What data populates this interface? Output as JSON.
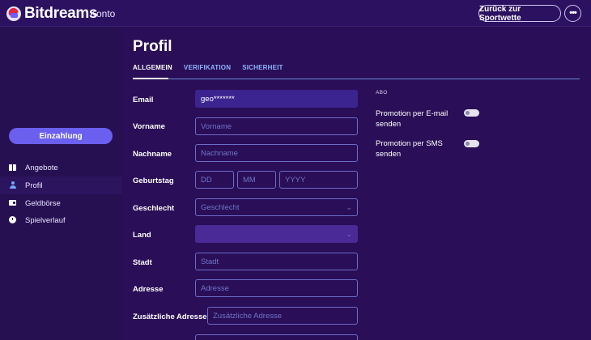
{
  "header": {
    "brand": "Bitdreams",
    "section": "Konto",
    "back_button": "Zurück zur Sportwette",
    "more_button": "•••",
    "logo_icon": "bitdreams-logo-icon",
    "more_icon": "ellipsis-icon"
  },
  "sidebar": {
    "deposit_button": "Einzahlung",
    "items": [
      {
        "label": "Angebote",
        "icon": "gift-icon",
        "active": false
      },
      {
        "label": "Profil",
        "icon": "person-icon",
        "active": true
      },
      {
        "label": "Geldbörse",
        "icon": "wallet-icon",
        "active": false
      },
      {
        "label": "Spielverlauf",
        "icon": "clock-icon",
        "active": false
      }
    ]
  },
  "main": {
    "title": "Profil",
    "tabs": [
      {
        "label": "ALLGEMEIN",
        "active": true
      },
      {
        "label": "VERIFIKATION",
        "active": false
      },
      {
        "label": "SICHERHEIT",
        "active": false
      }
    ],
    "form": {
      "email": {
        "label": "Email",
        "value": "geo*******"
      },
      "first_name": {
        "label": "Vorname",
        "placeholder": "Vorname"
      },
      "last_name": {
        "label": "Nachname",
        "placeholder": "Nachname"
      },
      "birthday": {
        "label": "Geburtstag",
        "day": "DD",
        "month": "MM",
        "year": "YYYY"
      },
      "gender": {
        "label": "Geschlecht",
        "placeholder": "Geschlecht"
      },
      "country": {
        "label": "Land",
        "value": ""
      },
      "city": {
        "label": "Stadt",
        "placeholder": "Stadt"
      },
      "address": {
        "label": "Adresse",
        "placeholder": "Adresse"
      },
      "address_extra": {
        "label": "Zusätzliche Adresse",
        "placeholder": "Zusätzliche Adresse"
      }
    },
    "abo": {
      "title": "ABO",
      "email_promo": {
        "label": "Promotion per E-mail senden",
        "enabled": false
      },
      "sms_promo": {
        "label": "Promotion per SMS senden",
        "enabled": false
      }
    }
  },
  "colors": {
    "background": "#2a0e57",
    "topbar": "#2b1160",
    "sidebar": "#261052",
    "accent": "#6b5ff0",
    "tab_link": "#8fb4ff",
    "input_border": "#6d6cc9"
  }
}
